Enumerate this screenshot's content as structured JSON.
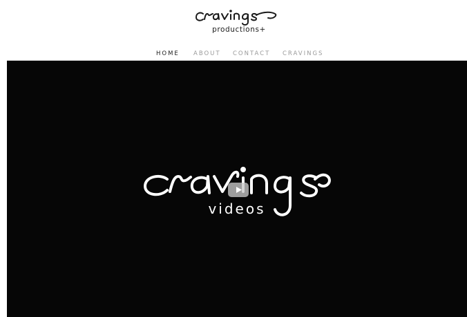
{
  "header": {
    "logo_script": "cravings",
    "logo_sub": "productions+"
  },
  "nav": {
    "items": [
      {
        "label": "HOME",
        "active": true
      },
      {
        "label": "ABOUT",
        "active": false
      },
      {
        "label": "CONTACT",
        "active": false
      },
      {
        "label": "CRAVINGS",
        "active": false
      }
    ]
  },
  "video": {
    "logo_script": "cravings",
    "logo_sub": "videos",
    "play_icon": "play-icon",
    "background": "#060606"
  },
  "colors": {
    "nav_active": "#1e1e1e",
    "nav_inactive": "#9a9a9a",
    "logo_ink": "#1a1a1a"
  }
}
